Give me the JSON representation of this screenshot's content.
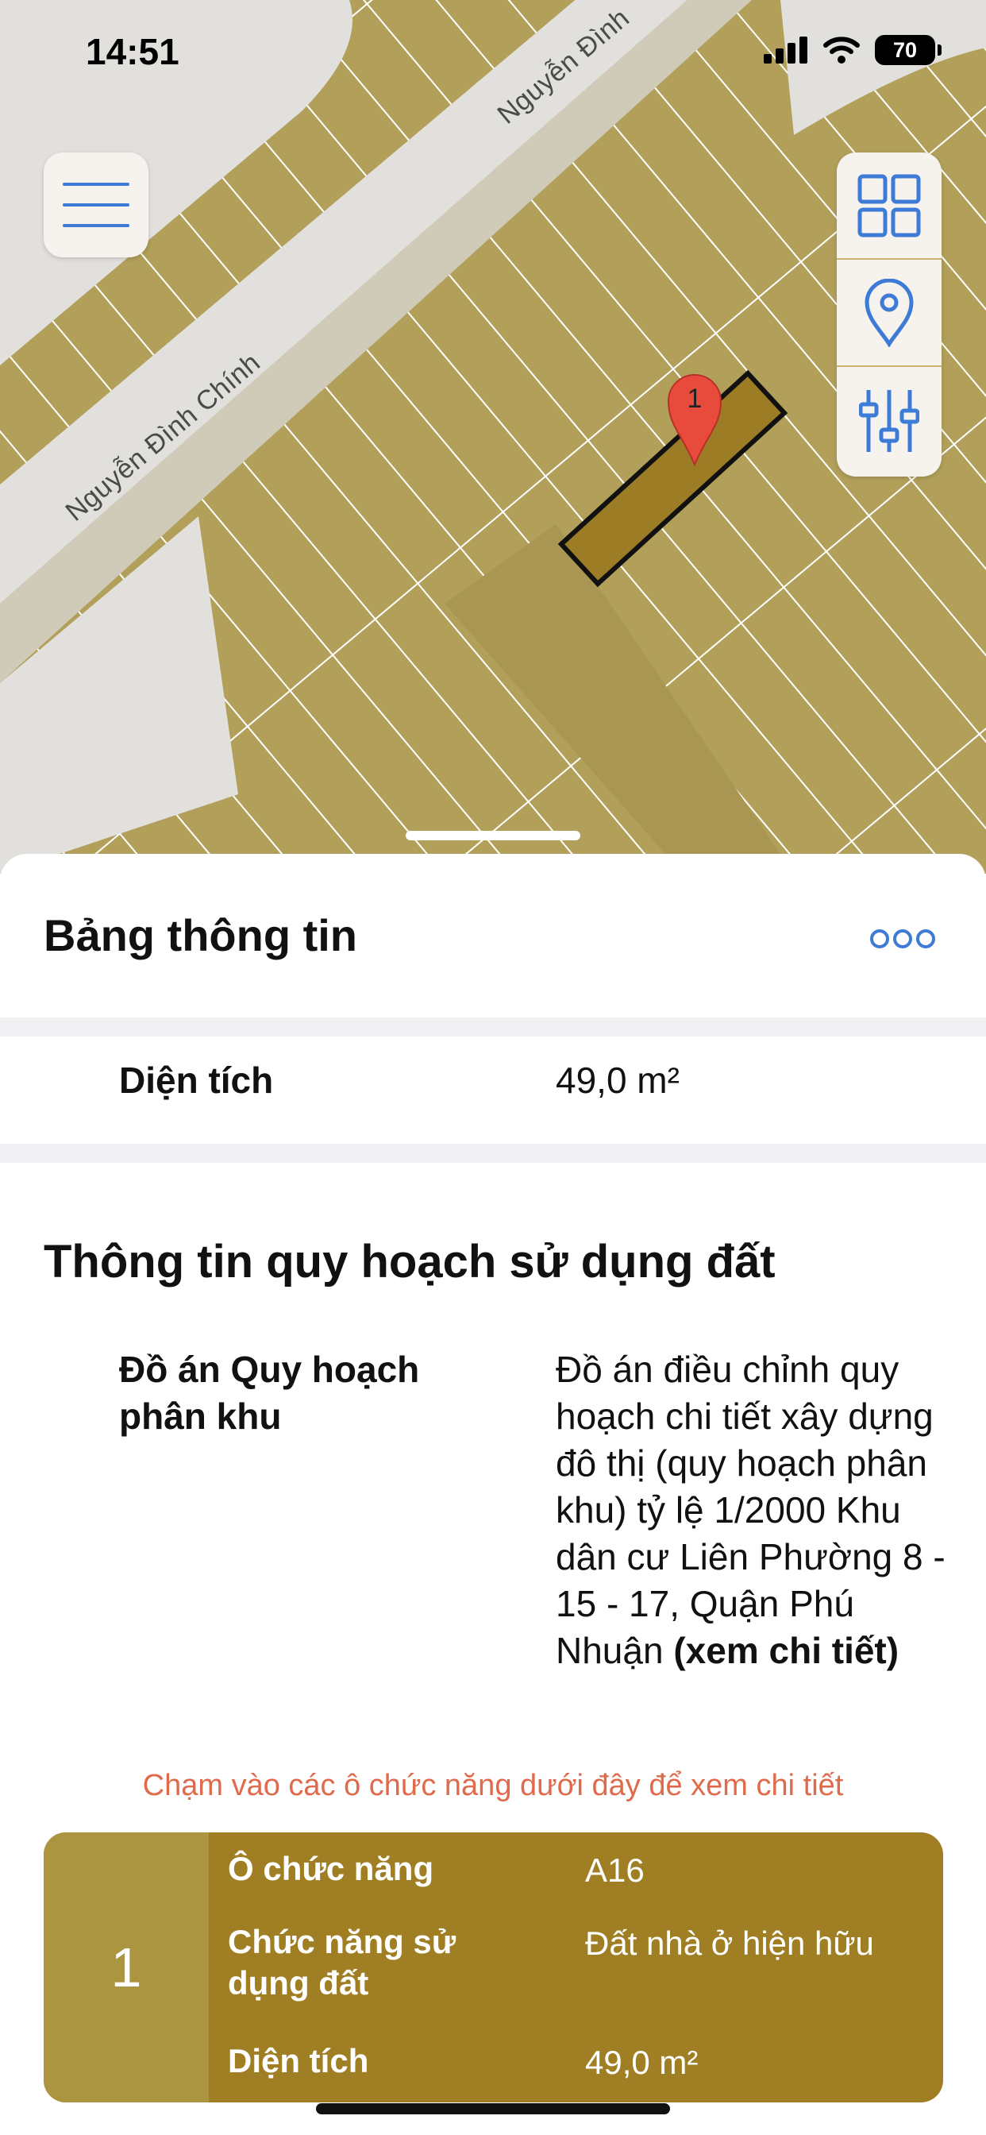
{
  "status_bar": {
    "time": "14:51",
    "battery": "70"
  },
  "map": {
    "road_labels": [
      "Nguyễn Đình Chính",
      "Nguyễn Đình"
    ],
    "marker_label": "1",
    "icons": {
      "menu": "hamburger-menu-icon",
      "layers": "grid-layers-icon",
      "locate": "location-pin-icon",
      "filters": "sliders-icon"
    },
    "colors": {
      "land": "#b19f5a",
      "road": "#e2e0dc",
      "selected_lot": "#9c7c25",
      "marker": "#e84a3c"
    }
  },
  "sheet": {
    "title": "Bảng thông tin",
    "more_icon": "more-dots-icon",
    "area_row": {
      "label": "Diện tích",
      "value": "49,0 m²"
    },
    "section_title": "Thông tin quy hoạch sử dụng đất",
    "plan": {
      "label": "Đồ án Quy hoạch phân khu",
      "value": "Đồ án điều chỉnh quy hoạch chi tiết xây dựng đô thị (quy hoạch phân khu) tỷ lệ 1/2000 Khu dân cư Liên Phường 8 - 15 - 17, Quận Phú Nhuận",
      "link": "(xem chi tiết)"
    },
    "hint": "Chạm vào các ô chức năng dưới đây để xem chi tiết",
    "card": {
      "number": "1",
      "rows": [
        {
          "label": "Ô chức năng",
          "value": "A16"
        },
        {
          "label": "Chức năng sử dụng đất",
          "value": "Đất nhà ở hiện hữu"
        },
        {
          "label": "Diện tích",
          "value": "49,0 m²"
        }
      ]
    },
    "accent_color": "#3d7bd6"
  }
}
